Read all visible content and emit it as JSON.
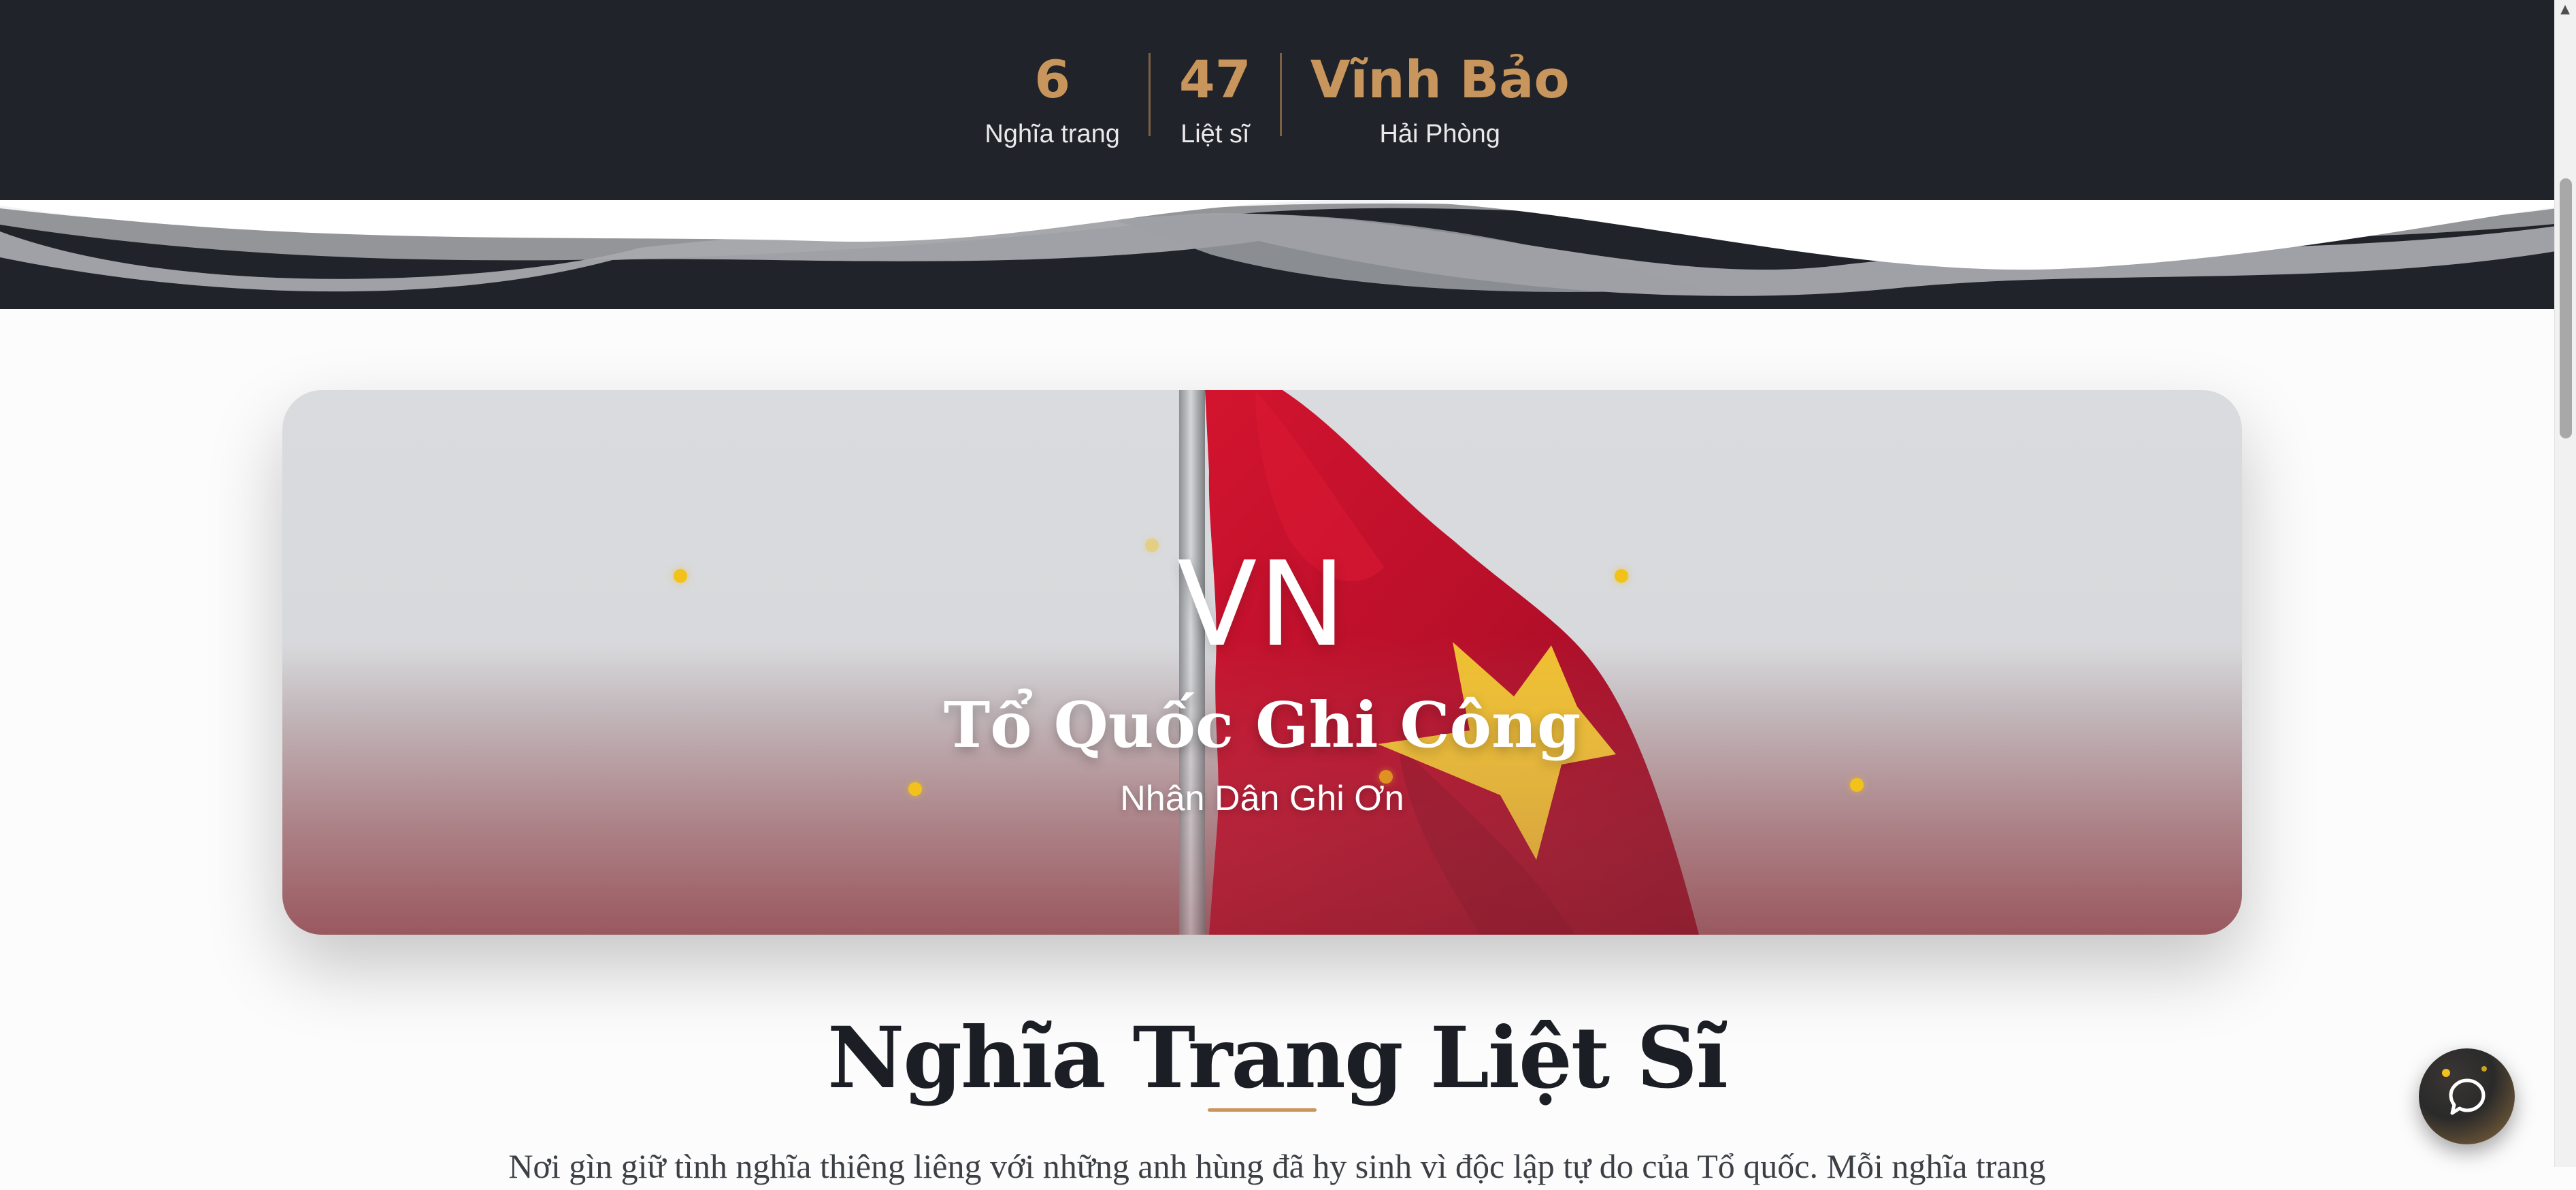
{
  "stats": [
    {
      "value": "6",
      "label": "Nghĩa trang"
    },
    {
      "value": "47",
      "label": "Liệt sĩ"
    },
    {
      "value": "Vĩnh Bảo",
      "label": "Hải Phòng"
    }
  ],
  "hero": {
    "badge": "VN",
    "title": "Tổ Quốc Ghi Công",
    "subtitle": "Nhân Dân Ghi Ơn"
  },
  "section": {
    "title": "Nghĩa Trang Liệt Sĩ",
    "description": "Nơi gìn giữ tình nghĩa thiêng liêng với những anh hùng đã hy sinh vì độc lập tự do của Tổ quốc. Mỗi nghĩa trang"
  },
  "icons": {
    "chat": "chat-bubble-icon",
    "scroll_up": "chevron-up-icon"
  },
  "colors": {
    "dark_bg": "#202329",
    "accent": "#c8955c",
    "flag_red": "#c8102e",
    "flag_star": "#f2c21a"
  }
}
